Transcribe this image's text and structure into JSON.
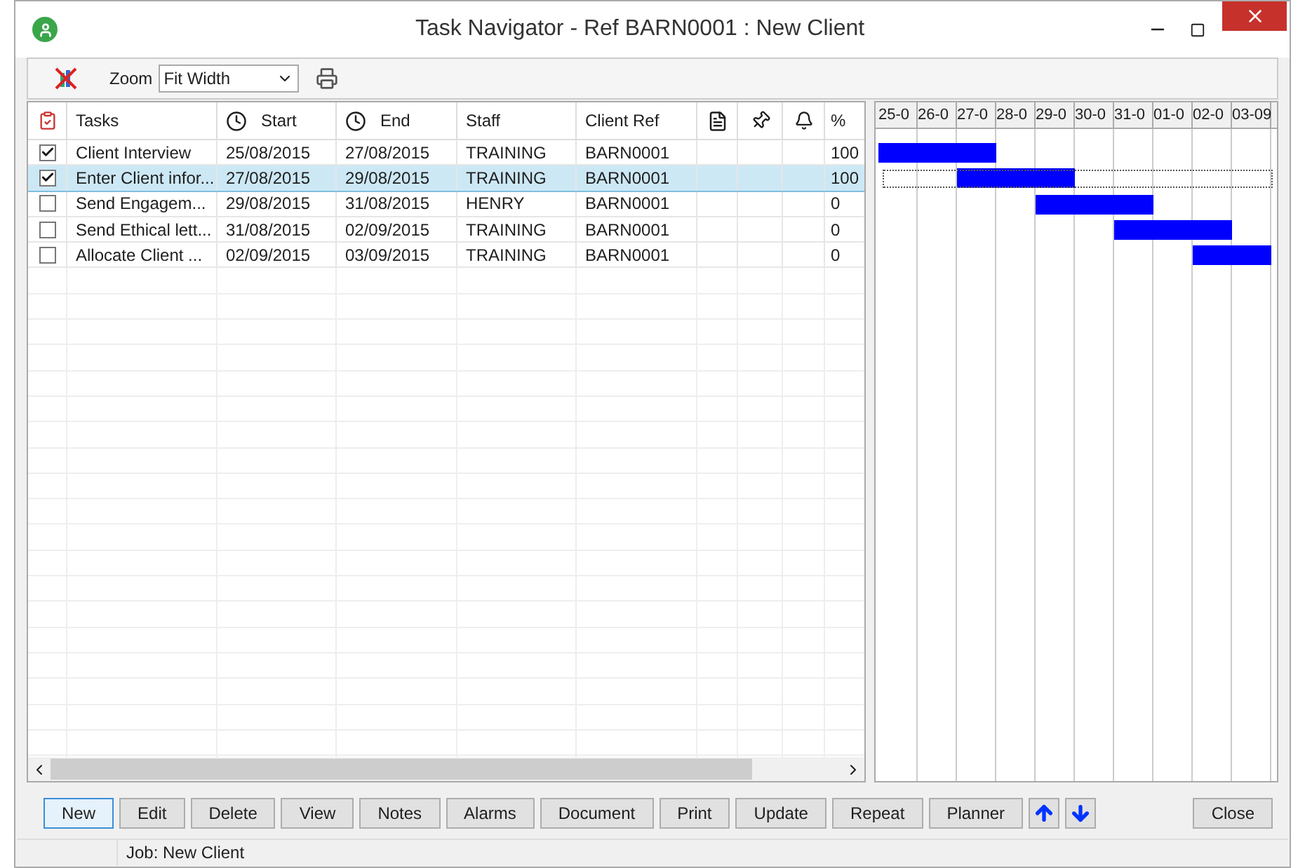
{
  "window": {
    "title": "Task Navigator - Ref BARN0001 : New Client"
  },
  "toolbar": {
    "zoom_label": "Zoom",
    "zoom_value": "Fit Width"
  },
  "table": {
    "columns": [
      "Tasks",
      "Start",
      "End",
      "Staff",
      "Client Ref",
      "%"
    ],
    "rows": [
      {
        "checked": true,
        "selected": false,
        "cells": [
          "Client Interview",
          "25/08/2015",
          "27/08/2015",
          "TRAINING",
          "BARN0001",
          "100"
        ]
      },
      {
        "checked": true,
        "selected": true,
        "cells": [
          "Enter Client infor...",
          "27/08/2015",
          "29/08/2015",
          "TRAINING",
          "BARN0001",
          "100"
        ]
      },
      {
        "checked": false,
        "selected": false,
        "cells": [
          "Send Engagem...",
          "29/08/2015",
          "31/08/2015",
          "HENRY",
          "BARN0001",
          "0"
        ]
      },
      {
        "checked": false,
        "selected": false,
        "cells": [
          "Send Ethical lett...",
          "31/08/2015",
          "02/09/2015",
          "TRAINING",
          "BARN0001",
          "0"
        ]
      },
      {
        "checked": false,
        "selected": false,
        "cells": [
          "Allocate Client ...",
          "02/09/2015",
          "03/09/2015",
          "TRAINING",
          "BARN0001",
          "0"
        ]
      }
    ]
  },
  "gantt": {
    "days": [
      "25-0",
      "26-0",
      "27-0",
      "28-0",
      "29-0",
      "30-0",
      "31-0",
      "01-0",
      "02-0",
      "03-09"
    ],
    "rows": [
      {
        "selected": false,
        "cells": [
          {
            "kind": "bar"
          },
          {
            "kind": "bar"
          },
          {
            "kind": "bar"
          },
          {
            "kind": "empty"
          },
          {
            "kind": "empty"
          },
          {
            "kind": "empty"
          },
          {
            "kind": "empty"
          },
          {
            "kind": "empty"
          },
          {
            "kind": "empty"
          },
          {
            "kind": "empty"
          }
        ]
      },
      {
        "selected": true,
        "cells": [
          {
            "kind": "empty"
          },
          {
            "kind": "empty"
          },
          {
            "kind": "bar"
          },
          {
            "kind": "bar"
          },
          {
            "kind": "bar"
          },
          {
            "kind": "empty"
          },
          {
            "kind": "empty"
          },
          {
            "kind": "empty"
          },
          {
            "kind": "empty"
          },
          {
            "kind": "empty"
          }
        ]
      },
      {
        "selected": false,
        "cells": [
          {
            "kind": "empty"
          },
          {
            "kind": "empty"
          },
          {
            "kind": "empty"
          },
          {
            "kind": "empty"
          },
          {
            "kind": "bar"
          },
          {
            "kind": "bar"
          },
          {
            "kind": "bar"
          },
          {
            "kind": "empty"
          },
          {
            "kind": "empty"
          },
          {
            "kind": "empty"
          }
        ]
      },
      {
        "selected": false,
        "cells": [
          {
            "kind": "empty"
          },
          {
            "kind": "empty"
          },
          {
            "kind": "empty"
          },
          {
            "kind": "empty"
          },
          {
            "kind": "empty"
          },
          {
            "kind": "empty"
          },
          {
            "kind": "bar"
          },
          {
            "kind": "bar"
          },
          {
            "kind": "bar"
          },
          {
            "kind": "empty"
          }
        ]
      },
      {
        "selected": false,
        "cells": [
          {
            "kind": "empty"
          },
          {
            "kind": "empty"
          },
          {
            "kind": "empty"
          },
          {
            "kind": "empty"
          },
          {
            "kind": "empty"
          },
          {
            "kind": "empty"
          },
          {
            "kind": "empty"
          },
          {
            "kind": "empty"
          },
          {
            "kind": "bar"
          },
          {
            "kind": "bar"
          }
        ]
      }
    ]
  },
  "buttons": [
    {
      "label": "New",
      "selected": true
    },
    {
      "label": "Edit",
      "selected": false
    },
    {
      "label": "Delete",
      "selected": false
    },
    {
      "label": "View",
      "selected": false
    },
    {
      "label": "Notes",
      "selected": false
    },
    {
      "label": "Alarms",
      "selected": false
    },
    {
      "label": "Document",
      "selected": false
    },
    {
      "label": "Print",
      "selected": false
    },
    {
      "label": "Update",
      "selected": false
    },
    {
      "label": "Repeat",
      "selected": false
    },
    {
      "label": "Planner",
      "selected": false
    }
  ],
  "close_button": "Close",
  "status_bar": "Job: New Client"
}
